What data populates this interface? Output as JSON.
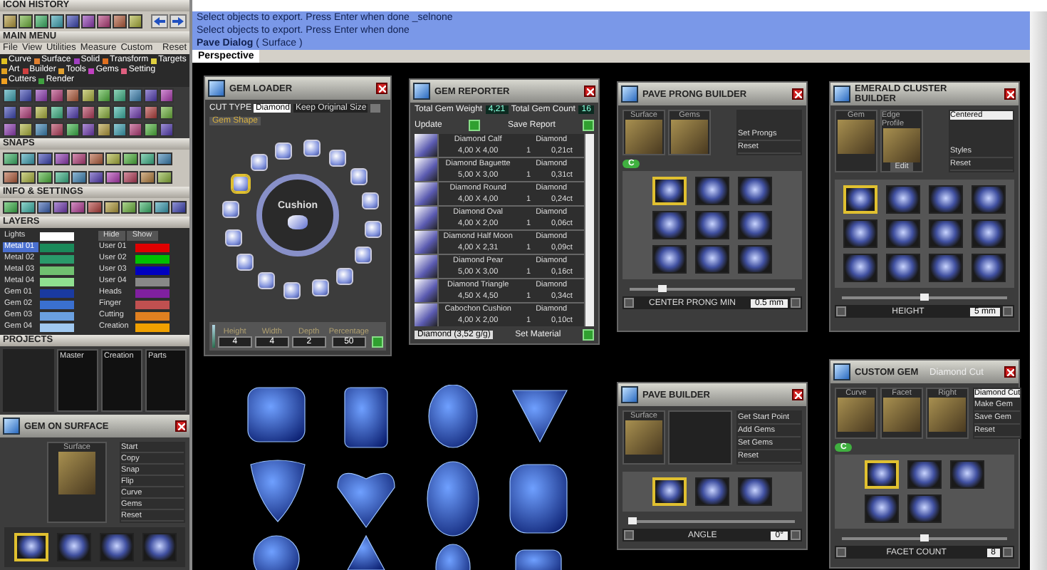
{
  "icon_history": {
    "title": "ICON HISTORY"
  },
  "main_menu": {
    "title": "MAIN MENU",
    "menu": [
      "File",
      "View",
      "Utilities",
      "Measure",
      "Custom"
    ],
    "reset": "Reset",
    "categories": [
      {
        "label": "Curve",
        "color": "#e0c020"
      },
      {
        "label": "Surface",
        "color": "#e08030"
      },
      {
        "label": "Solid",
        "color": "#a040c0"
      },
      {
        "label": "Transform",
        "color": "#e07020"
      },
      {
        "label": "Targets",
        "color": "#e0d040"
      },
      {
        "label": "Art",
        "color": "#e0a020"
      },
      {
        "label": "Builder",
        "color": "#d04040"
      },
      {
        "label": "Tools",
        "color": "#e0a030"
      },
      {
        "label": "Gems",
        "color": "#c040c0"
      },
      {
        "label": "Setting",
        "color": "#e06080"
      },
      {
        "label": "Cutters",
        "color": "#f0a020"
      },
      {
        "label": "Render",
        "color": "#40a040"
      }
    ]
  },
  "snaps": {
    "title": "SNAPS"
  },
  "info_settings": {
    "title": "INFO & SETTINGS"
  },
  "layers": {
    "title": "LAYERS",
    "hide": "Hide",
    "show": "Show",
    "lights": {
      "name": "Lights",
      "color": "#ffffff"
    },
    "left": [
      {
        "name": "Metal 01",
        "color": "#1a8a5a",
        "selected": true
      },
      {
        "name": "Metal 02",
        "color": "#2a9a6a",
        "selected": false
      },
      {
        "name": "Metal 03",
        "color": "#70c070",
        "selected": false
      },
      {
        "name": "Metal 04",
        "color": "#90e090",
        "selected": false
      },
      {
        "name": "Gem 01",
        "color": "#1a3aa0",
        "selected": false
      },
      {
        "name": "Gem 02",
        "color": "#3a70d0",
        "selected": false
      },
      {
        "name": "Gem 03",
        "color": "#6aa0e0",
        "selected": false
      },
      {
        "name": "Gem 04",
        "color": "#a0c8f0",
        "selected": false
      }
    ],
    "right": [
      {
        "name": "User 01",
        "color": "#e00000",
        "selected": false
      },
      {
        "name": "User 02",
        "color": "#00c000",
        "selected": false
      },
      {
        "name": "User 03",
        "color": "#0000c0",
        "selected": false
      },
      {
        "name": "User 04",
        "color": "#888888",
        "selected": false
      },
      {
        "name": "Heads",
        "color": "#8020a0",
        "selected": false
      },
      {
        "name": "Finger",
        "color": "#c05050",
        "selected": false
      },
      {
        "name": "Cutting",
        "color": "#e08020",
        "selected": false
      },
      {
        "name": "Creation",
        "color": "#f0a000",
        "selected": false
      }
    ]
  },
  "projects": {
    "title": "PROJECTS",
    "columns": [
      "Master",
      "Creation",
      "Parts"
    ]
  },
  "gem_on_surface": {
    "title": "GEM ON SURFACE",
    "thumbs": [
      {
        "label": "Surface"
      }
    ],
    "side": [
      "Start",
      "Copy",
      "Snap",
      "Flip",
      "Curve",
      "Gems",
      "Reset"
    ],
    "tiles": [
      {
        "selected": true
      },
      {
        "selected": false
      },
      {
        "selected": false
      },
      {
        "selected": false
      }
    ]
  },
  "command_lines": [
    "Select objects to export. Press Enter when done _selnone",
    "Select objects to export. Press Enter when done",
    "**Pave Dialog** ( Surface )"
  ],
  "viewport": {
    "tab": "Perspective"
  },
  "gem_loader": {
    "title": "GEM LOADER",
    "cut_type_label": "CUT TYPE",
    "cut_type": "Diamond",
    "keep_size": "Keep Original Size",
    "keep_size_checked": false,
    "tab": "Gem Shape",
    "shape": "Cushion",
    "shapes": [
      {
        "selected": true
      },
      {
        "selected": false
      },
      {
        "selected": false
      },
      {
        "selected": false
      },
      {
        "selected": false
      },
      {
        "selected": false
      },
      {
        "selected": false
      },
      {
        "selected": false
      },
      {
        "selected": false
      },
      {
        "selected": false
      },
      {
        "selected": false
      },
      {
        "selected": false
      },
      {
        "selected": false
      },
      {
        "selected": false
      },
      {
        "selected": false
      },
      {
        "selected": false
      }
    ],
    "dims": [
      {
        "label": "Height",
        "value": "4"
      },
      {
        "label": "Width",
        "value": "4"
      },
      {
        "label": "Depth",
        "value": "2"
      },
      {
        "label": "Percentage",
        "value": "50"
      }
    ]
  },
  "gem_reporter": {
    "title": "GEM REPORTER",
    "total_weight_label": "Total Gem Weight",
    "total_weight": "4,21",
    "total_count_label": "Total Gem Count",
    "total_count": "16",
    "update": "Update",
    "save_report": "Save Report",
    "rows": [
      {
        "name": "Diamond Calf",
        "material": "Diamond",
        "size": "4,00 X 4,00",
        "count": "1",
        "weight": "0,21ct"
      },
      {
        "name": "Diamond Baguette",
        "material": "Diamond",
        "size": "5,00 X 3,00",
        "count": "1",
        "weight": "0,31ct"
      },
      {
        "name": "Diamond Round",
        "material": "Diamond",
        "size": "4,00 X 4,00",
        "count": "1",
        "weight": "0,24ct"
      },
      {
        "name": "Diamond Oval",
        "material": "Diamond",
        "size": "4,00 X 2,00",
        "count": "1",
        "weight": "0,06ct"
      },
      {
        "name": "Diamond Half Moon",
        "material": "Diamond",
        "size": "4,00 X 2,31",
        "count": "1",
        "weight": "0,09ct"
      },
      {
        "name": "Diamond Pear",
        "material": "Diamond",
        "size": "5,00 X 3,00",
        "count": "1",
        "weight": "0,16ct"
      },
      {
        "name": "Diamond Triangle",
        "material": "Diamond",
        "size": "4,50 X 4,50",
        "count": "1",
        "weight": "0,34ct"
      },
      {
        "name": "Cabochon Cushion",
        "material": "Diamond",
        "size": "4,00 X 2,00",
        "count": "1",
        "weight": "0,10ct"
      }
    ],
    "material": "Diamond (3,52 g/g)",
    "set_material": "Set Material"
  },
  "builders": [
    {
      "kind": "prong",
      "title": "PAVE PRONG BUILDER",
      "thumbs": [
        {
          "label": "Surface"
        },
        {
          "label": "Gems"
        }
      ],
      "side": [
        "Set Prongs",
        "Reset"
      ],
      "badge": "C",
      "tiles": [
        {
          "selected": true
        },
        {
          "selected": false
        },
        {
          "selected": false
        },
        {
          "selected": false
        },
        {
          "selected": false
        },
        {
          "selected": false
        },
        {
          "selected": false
        },
        {
          "selected": false
        },
        {
          "selected": false
        }
      ],
      "level": 0.2,
      "label": "CENTER PRONG MIN",
      "value": "0.5 mm"
    },
    {
      "kind": "emerald",
      "title": "EMERALD CLUSTER BUILDER",
      "thumbs": [
        {
          "label": "Gem"
        },
        {
          "label": "Edge Profile",
          "button": "Edit"
        }
      ],
      "dropdown": "Centered",
      "side": [
        "Styles",
        "Reset"
      ],
      "tiles": [
        {
          "selected": true
        },
        {
          "selected": false
        },
        {
          "selected": false
        },
        {
          "selected": false
        },
        {
          "selected": false
        },
        {
          "selected": false
        },
        {
          "selected": false
        },
        {
          "selected": false
        },
        {
          "selected": false
        },
        {
          "selected": false
        },
        {
          "selected": false
        },
        {
          "selected": false
        }
      ],
      "level": 0.5,
      "label": "HEIGHT",
      "value": "5 mm"
    },
    {
      "kind": "pave",
      "title": "PAVE BUILDER",
      "thumbs": [
        {
          "label": "Surface"
        }
      ],
      "side": [
        "Get Start Point",
        "Add Gems",
        "Set Gems",
        "Reset"
      ],
      "tiles": [
        {
          "selected": true
        },
        {
          "selected": false
        },
        {
          "selected": false
        }
      ],
      "level": 0.02,
      "label": "ANGLE",
      "value": "0°"
    },
    {
      "kind": "custom",
      "title": "CUSTOM GEM",
      "subtitle": "Diamond Cut",
      "thumbs": [
        {
          "label": "Curve"
        },
        {
          "label": "Facet"
        },
        {
          "label": "Right"
        }
      ],
      "dropdown": "Diamond Cut",
      "side": [
        "Make Gem",
        "Save Gem",
        "Reset"
      ],
      "badge": "C",
      "tiles": [
        {
          "selected": true
        },
        {
          "selected": false
        },
        {
          "selected": false
        },
        {
          "selected": false
        },
        {
          "selected": false
        }
      ],
      "level": 0.5,
      "label": "FACET COUNT",
      "value": "8"
    }
  ]
}
